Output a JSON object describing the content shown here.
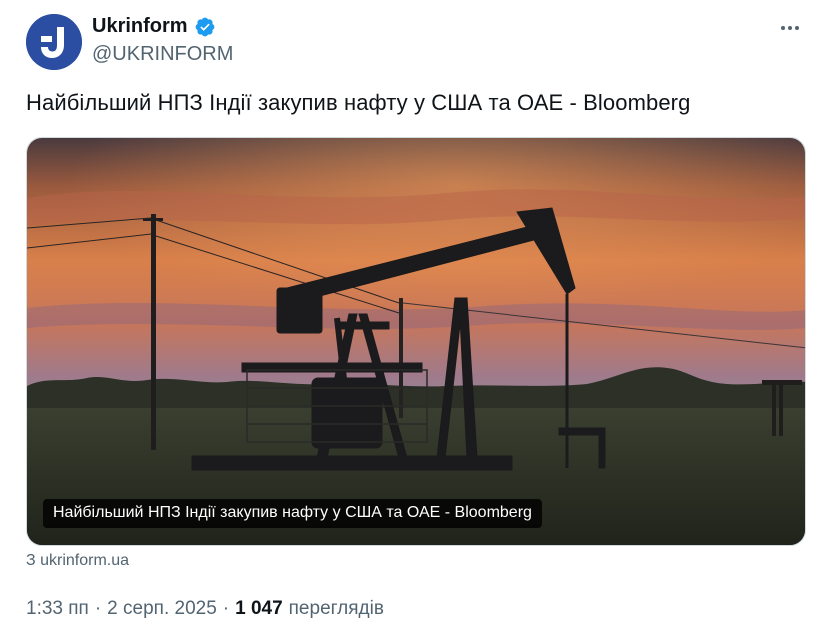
{
  "author": {
    "display_name": "Ukrinform",
    "handle": "@UKRINFORM",
    "avatar_icon": "ukrinform-logo-icon",
    "verified_icon": "verified-badge-icon",
    "verified_color": "#1d9bf0",
    "avatar_color": "#2b4ea2"
  },
  "menu_icon": "more-options-icon",
  "tweet_text": "Найбільший НПЗ Індії закупив нафту у США та ОАЕ - Bloomberg",
  "card": {
    "caption": "Найбільший НПЗ Індії закупив нафту у США та ОАЕ - Bloomberg",
    "source": "З ukrinform.ua"
  },
  "meta": {
    "time": "1:33 пп",
    "separator": "·",
    "date": "2 серп. 2025",
    "views_count": "1 047",
    "views_label": "переглядів"
  }
}
